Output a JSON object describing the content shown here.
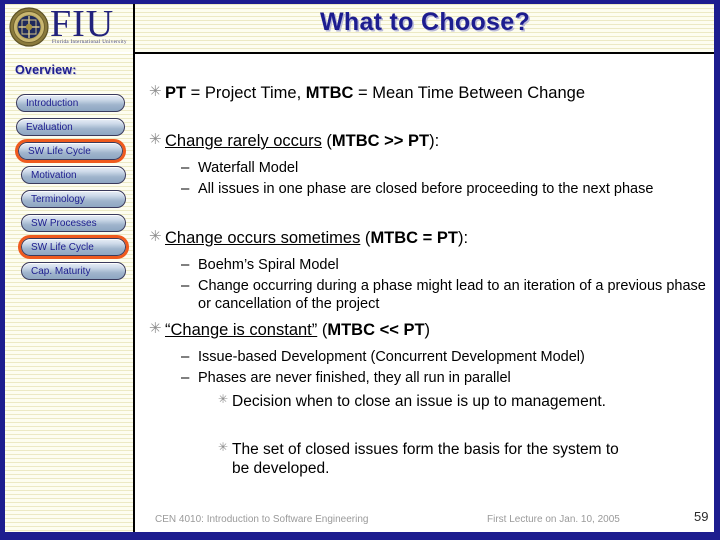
{
  "slide": {
    "title": "What to Choose?",
    "logo": {
      "letters": "FIU",
      "subtitle": "Florida International University",
      "seal_name": "fiu-seal-icon"
    }
  },
  "sidebar": {
    "heading": "Overview:",
    "items": [
      {
        "label": "Introduction",
        "indent": false,
        "highlighted": false
      },
      {
        "label": "Evaluation",
        "indent": false,
        "highlighted": false
      },
      {
        "label": "SW Life Cycle",
        "indent": false,
        "highlighted": true
      },
      {
        "label": "Motivation",
        "indent": true,
        "highlighted": false
      },
      {
        "label": "Terminology",
        "indent": true,
        "highlighted": false
      },
      {
        "label": "SW Processes",
        "indent": true,
        "highlighted": false
      },
      {
        "label": "SW Life Cycle",
        "indent": true,
        "highlighted": true
      },
      {
        "label": "Cap. Maturity",
        "indent": true,
        "highlighted": false
      }
    ]
  },
  "body": {
    "bullet_glyph": "✳",
    "dash_glyph": "–",
    "b1": {
      "pt_abbr": "PT",
      "pt_rest": " = Project Time, ",
      "mtbc_abbr": "MTBC",
      "mtbc_rest": " = Mean Time Between Change"
    },
    "b2": {
      "underlined": "Change rarely occurs",
      "paren_open": " (",
      "bold": "MTBC >> PT",
      "paren_close": "):"
    },
    "b2_subs": [
      "Waterfall Model",
      "All issues in one phase are closed before proceeding to the next phase"
    ],
    "b3": {
      "underlined": "Change occurs sometimes",
      "paren_open": " (",
      "bold": "MTBC = PT",
      "paren_close": "):"
    },
    "b3_subs": [
      "Boehm’s Spiral Model",
      "Change occurring during a phase might lead to an iteration of a previous phase or cancellation of the project"
    ],
    "b4": {
      "underlined": "“Change is constant”",
      "paren_open": " (",
      "bold": "MTBC << PT",
      "paren_close": ")"
    },
    "b4_subs": [
      "Issue-based Development (Concurrent Development Model)",
      "Phases are never finished, they all run in parallel"
    ],
    "b4_subsubs": [
      "Decision when to close an issue is up to management.",
      "The set of closed issues form the basis for the system to be developed."
    ]
  },
  "footer": {
    "course": "CEN 4010: Introduction to Software Engineering",
    "lecture": "First Lecture on Jan. 10, 2005",
    "slide_number": "59"
  },
  "colors": {
    "navy_frame": "#1d1d8f",
    "title_blue": "#1d1d8f",
    "highlight_orange": "#ef5a1e",
    "stripe_cream": "#fbfbe8",
    "footer_gray": "#9a9a9a"
  }
}
